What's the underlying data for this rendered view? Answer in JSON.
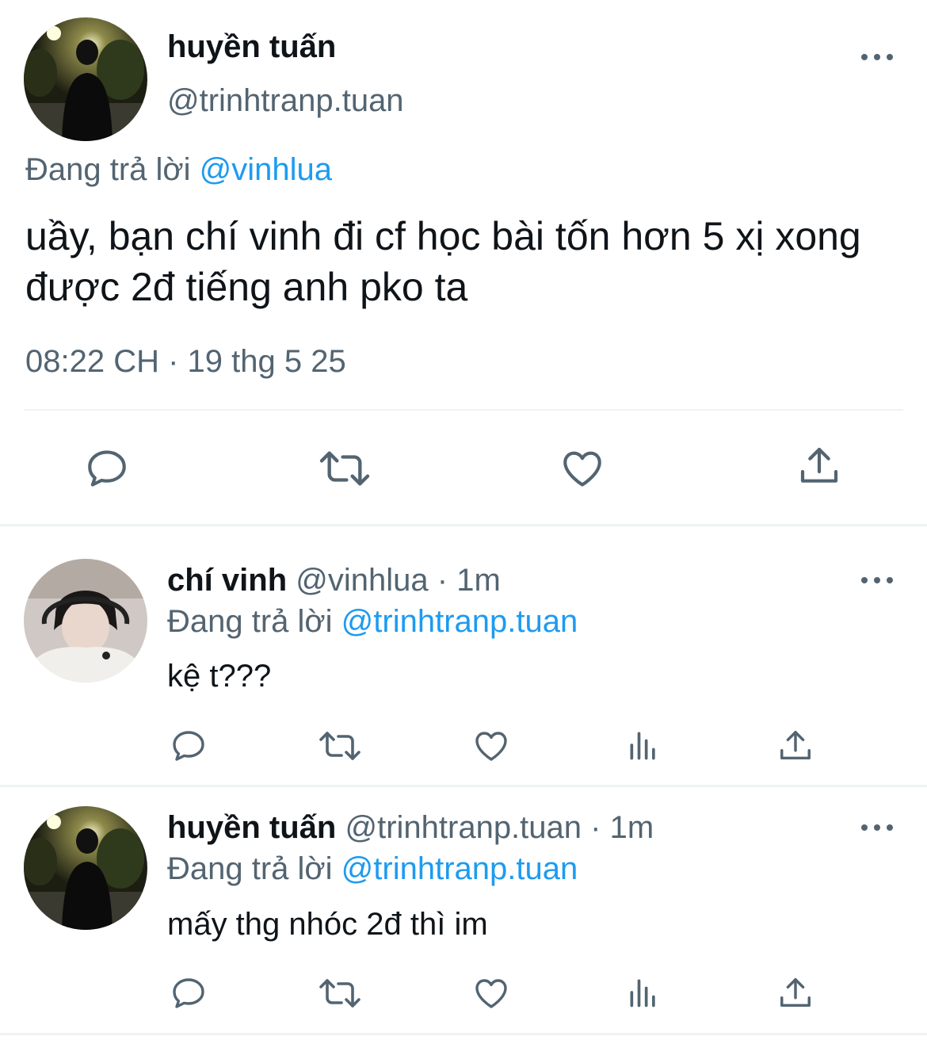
{
  "main_tweet": {
    "author_name": "huyền tuấn",
    "author_handle": "@trinhtranp.tuan",
    "replying_label": "Đang trả lời",
    "replying_to": "@vinhlua",
    "text": "uầy, bạn chí vinh đi cf học bài tốn hơn 5 xị xong được 2đ tiếng anh pko ta",
    "timestamp": "08:22 CH · 19 thg 5 25",
    "actions": [
      "reply-icon",
      "retweet-icon",
      "like-icon",
      "share-icon"
    ]
  },
  "replies": [
    {
      "author_name": "chí vinh",
      "author_handle": "@vinhlua",
      "time": "· 1m",
      "replying_label": "Đang trả lời",
      "replying_to": "@trinhtranp.tuan",
      "text": "kệ t???",
      "actions": [
        "reply-icon",
        "retweet-icon",
        "like-icon",
        "views-icon",
        "share-icon"
      ]
    },
    {
      "author_name": "huyền tuấn",
      "author_handle": "@trinhtranp.tuan",
      "time": "· 1m",
      "replying_label": "Đang trả lời",
      "replying_to": "@trinhtranp.tuan",
      "text": "mấy thg nhóc 2đ thì im",
      "actions": [
        "reply-icon",
        "retweet-icon",
        "like-icon",
        "views-icon",
        "share-icon"
      ]
    }
  ],
  "colors": {
    "text": "#0f1419",
    "secondary": "#536471",
    "link": "#1d9bf0",
    "divider": "#eff3f4"
  }
}
